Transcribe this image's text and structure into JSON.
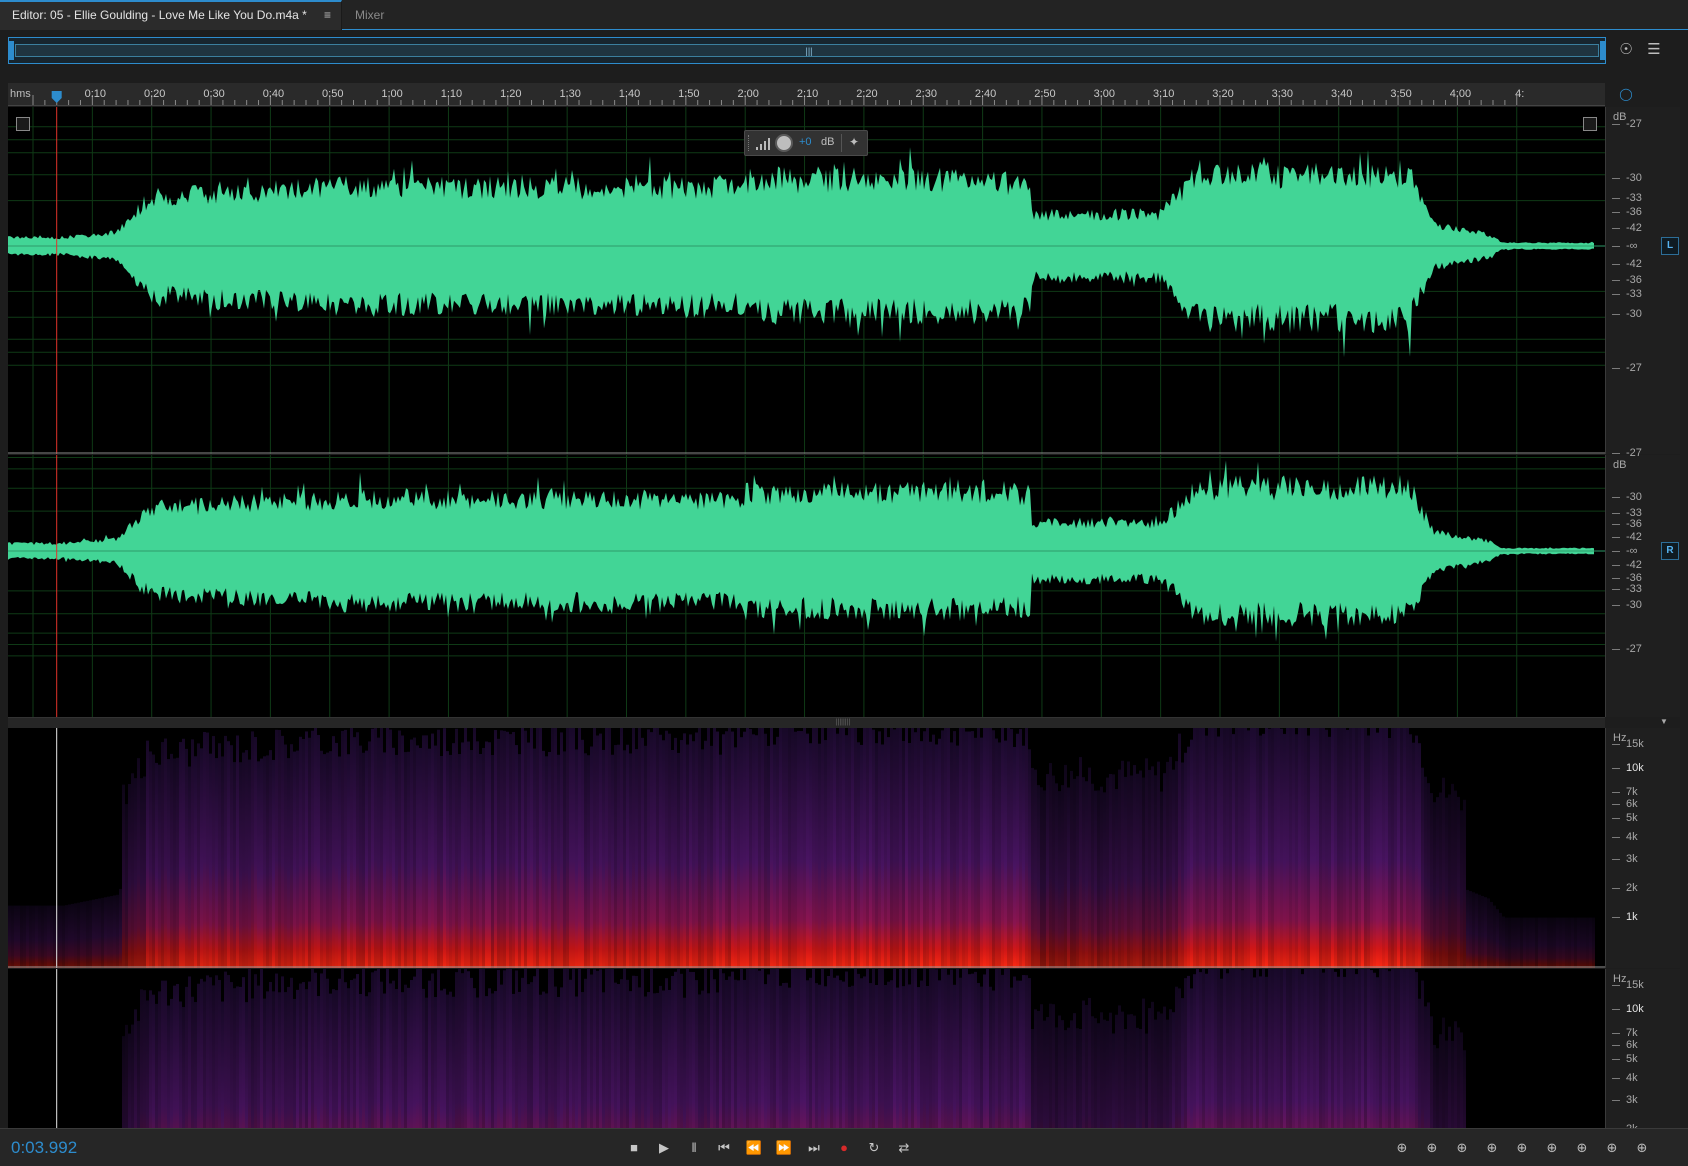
{
  "tabs": [
    {
      "label": "Editor: 05 - Ellie Goulding - Love Me Like You Do.m4a *",
      "active": true
    },
    {
      "label": "Mixer",
      "active": false
    }
  ],
  "tab_menu_icon": "hamburger-icon",
  "ruler": {
    "unit_label": "hms",
    "labels": [
      "0:10",
      "0:20",
      "0:30",
      "0:40",
      "0:50",
      "1:00",
      "1:10",
      "1:20",
      "1:30",
      "1:40",
      "1:50",
      "2:00",
      "2:10",
      "2:20",
      "2:30",
      "2:40",
      "2:50",
      "3:00",
      "3:10",
      "3:20",
      "3:30",
      "3:40",
      "3:50",
      "4:00",
      "4:"
    ],
    "seconds_per_label": 10,
    "visible_duration_seconds": 251
  },
  "playhead_seconds": 3.992,
  "hud": {
    "value": "+0",
    "unit": "dB"
  },
  "amplitude_scale": {
    "unit": "dB",
    "labels_upper": [
      "-27",
      "-30",
      "-33",
      "-36",
      "-42"
    ],
    "center": "-∞",
    "labels_lower": [
      "-42",
      "-36",
      "-33",
      "-30",
      "-27"
    ]
  },
  "channels": {
    "left": "L",
    "right": "R"
  },
  "frequency_scale": {
    "unit": "Hz",
    "labels": [
      "15k",
      "10k",
      "7k",
      "6k",
      "5k",
      "4k",
      "3k",
      "2k",
      "1k"
    ]
  },
  "colors": {
    "waveform": "#42d596",
    "accent": "#2d8ccd",
    "playhead": "#e0332b",
    "record": "#d72a2a",
    "grid": "#0f3a16"
  },
  "time_display": "0:03.992",
  "transport_icons": [
    "stop-icon",
    "play-icon",
    "pause-icon",
    "go-to-start-icon",
    "rewind-icon",
    "fast-forward-icon",
    "go-to-end-icon",
    "record-icon",
    "loop-playback-icon",
    "skip-selection-icon"
  ],
  "zoom_icons": [
    "zoom-in-amplitude-icon",
    "zoom-out-amplitude-icon",
    "zoom-in-time-icon",
    "zoom-out-time-icon",
    "zoom-out-full-icon",
    "zoom-in-at-start-icon",
    "zoom-in-at-end-icon",
    "zoom-to-selection-icon",
    "zoom-selection-left-icon",
    "zoom-selection-right-icon"
  ]
}
